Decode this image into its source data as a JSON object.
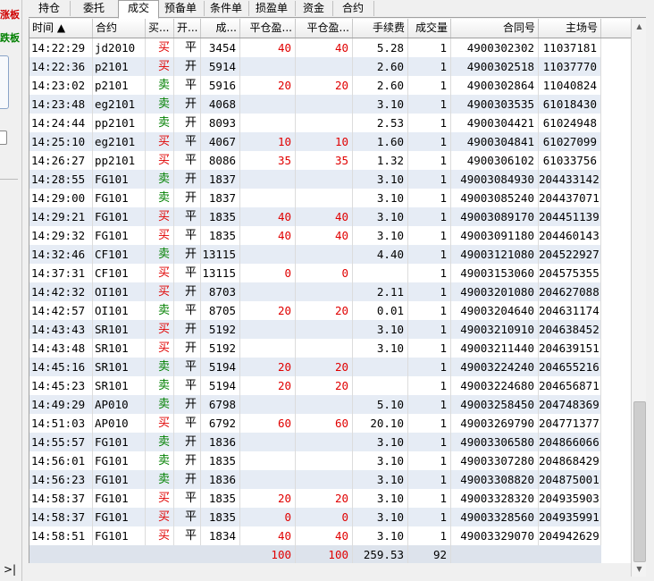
{
  "left_panel": {
    "label_1": "涨板",
    "label_2": "跌板",
    "bottom_glyph": ">|"
  },
  "tabs": [
    "持仓",
    "委托",
    "成交",
    "预备单",
    "条件单",
    "损盈单",
    "资金",
    "合约"
  ],
  "active_tab": "成交",
  "columns": [
    "时间 ▲",
    "合约",
    "买...",
    "开...",
    "成...",
    "平仓盈...",
    "平仓盈...",
    "手续费",
    "成交量",
    "合同号",
    "主场号"
  ],
  "rows": [
    {
      "time": "14:22:29",
      "contract": "jd2010",
      "side": "买",
      "oc": "平",
      "price": "3454",
      "pnl1": "40",
      "pnl2": "40",
      "fee": "5.28",
      "qty": "1",
      "order_no": "4900302302",
      "main_no": "11037181"
    },
    {
      "time": "14:22:36",
      "contract": "p2101",
      "side": "买",
      "oc": "开",
      "price": "5914",
      "pnl1": "",
      "pnl2": "",
      "fee": "2.60",
      "qty": "1",
      "order_no": "4900302518",
      "main_no": "11037770"
    },
    {
      "time": "14:23:02",
      "contract": "p2101",
      "side": "卖",
      "oc": "平",
      "price": "5916",
      "pnl1": "20",
      "pnl2": "20",
      "fee": "2.60",
      "qty": "1",
      "order_no": "4900302864",
      "main_no": "11040824"
    },
    {
      "time": "14:23:48",
      "contract": "eg2101",
      "side": "卖",
      "oc": "开",
      "price": "4068",
      "pnl1": "",
      "pnl2": "",
      "fee": "3.10",
      "qty": "1",
      "order_no": "4900303535",
      "main_no": "61018430"
    },
    {
      "time": "14:24:44",
      "contract": "pp2101",
      "side": "卖",
      "oc": "开",
      "price": "8093",
      "pnl1": "",
      "pnl2": "",
      "fee": "2.53",
      "qty": "1",
      "order_no": "4900304421",
      "main_no": "61024948"
    },
    {
      "time": "14:25:10",
      "contract": "eg2101",
      "side": "买",
      "oc": "平",
      "price": "4067",
      "pnl1": "10",
      "pnl2": "10",
      "fee": "1.60",
      "qty": "1",
      "order_no": "4900304841",
      "main_no": "61027099"
    },
    {
      "time": "14:26:27",
      "contract": "pp2101",
      "side": "买",
      "oc": "平",
      "price": "8086",
      "pnl1": "35",
      "pnl2": "35",
      "fee": "1.32",
      "qty": "1",
      "order_no": "4900306102",
      "main_no": "61033756"
    },
    {
      "time": "14:28:55",
      "contract": "FG101",
      "side": "卖",
      "oc": "开",
      "price": "1837",
      "pnl1": "",
      "pnl2": "",
      "fee": "3.10",
      "qty": "1",
      "order_no": "49003084930",
      "main_no": "204433142"
    },
    {
      "time": "14:29:00",
      "contract": "FG101",
      "side": "卖",
      "oc": "开",
      "price": "1837",
      "pnl1": "",
      "pnl2": "",
      "fee": "3.10",
      "qty": "1",
      "order_no": "49003085240",
      "main_no": "204437071"
    },
    {
      "time": "14:29:21",
      "contract": "FG101",
      "side": "买",
      "oc": "平",
      "price": "1835",
      "pnl1": "40",
      "pnl2": "40",
      "fee": "3.10",
      "qty": "1",
      "order_no": "49003089170",
      "main_no": "204451139"
    },
    {
      "time": "14:29:32",
      "contract": "FG101",
      "side": "买",
      "oc": "平",
      "price": "1835",
      "pnl1": "40",
      "pnl2": "40",
      "fee": "3.10",
      "qty": "1",
      "order_no": "49003091180",
      "main_no": "204460143"
    },
    {
      "time": "14:32:46",
      "contract": "CF101",
      "side": "卖",
      "oc": "开",
      "price": "13115",
      "pnl1": "",
      "pnl2": "",
      "fee": "4.40",
      "qty": "1",
      "order_no": "49003121080",
      "main_no": "204522927"
    },
    {
      "time": "14:37:31",
      "contract": "CF101",
      "side": "买",
      "oc": "平",
      "price": "13115",
      "pnl1": "0",
      "pnl2": "0",
      "fee": "",
      "qty": "1",
      "order_no": "49003153060",
      "main_no": "204575355"
    },
    {
      "time": "14:42:32",
      "contract": "OI101",
      "side": "买",
      "oc": "开",
      "price": "8703",
      "pnl1": "",
      "pnl2": "",
      "fee": "2.11",
      "qty": "1",
      "order_no": "49003201080",
      "main_no": "204627088"
    },
    {
      "time": "14:42:57",
      "contract": "OI101",
      "side": "卖",
      "oc": "平",
      "price": "8705",
      "pnl1": "20",
      "pnl2": "20",
      "fee": "0.01",
      "qty": "1",
      "order_no": "49003204640",
      "main_no": "204631174"
    },
    {
      "time": "14:43:43",
      "contract": "SR101",
      "side": "买",
      "oc": "开",
      "price": "5192",
      "pnl1": "",
      "pnl2": "",
      "fee": "3.10",
      "qty": "1",
      "order_no": "49003210910",
      "main_no": "204638452"
    },
    {
      "time": "14:43:48",
      "contract": "SR101",
      "side": "买",
      "oc": "开",
      "price": "5192",
      "pnl1": "",
      "pnl2": "",
      "fee": "3.10",
      "qty": "1",
      "order_no": "49003211440",
      "main_no": "204639151"
    },
    {
      "time": "14:45:16",
      "contract": "SR101",
      "side": "卖",
      "oc": "平",
      "price": "5194",
      "pnl1": "20",
      "pnl2": "20",
      "fee": "",
      "qty": "1",
      "order_no": "49003224240",
      "main_no": "204655216"
    },
    {
      "time": "14:45:23",
      "contract": "SR101",
      "side": "卖",
      "oc": "平",
      "price": "5194",
      "pnl1": "20",
      "pnl2": "20",
      "fee": "",
      "qty": "1",
      "order_no": "49003224680",
      "main_no": "204656871"
    },
    {
      "time": "14:49:29",
      "contract": "AP010",
      "side": "卖",
      "oc": "开",
      "price": "6798",
      "pnl1": "",
      "pnl2": "",
      "fee": "5.10",
      "qty": "1",
      "order_no": "49003258450",
      "main_no": "204748369"
    },
    {
      "time": "14:51:03",
      "contract": "AP010",
      "side": "买",
      "oc": "平",
      "price": "6792",
      "pnl1": "60",
      "pnl2": "60",
      "fee": "20.10",
      "qty": "1",
      "order_no": "49003269790",
      "main_no": "204771377"
    },
    {
      "time": "14:55:57",
      "contract": "FG101",
      "side": "卖",
      "oc": "开",
      "price": "1836",
      "pnl1": "",
      "pnl2": "",
      "fee": "3.10",
      "qty": "1",
      "order_no": "49003306580",
      "main_no": "204866066"
    },
    {
      "time": "14:56:01",
      "contract": "FG101",
      "side": "卖",
      "oc": "开",
      "price": "1835",
      "pnl1": "",
      "pnl2": "",
      "fee": "3.10",
      "qty": "1",
      "order_no": "49003307280",
      "main_no": "204868429"
    },
    {
      "time": "14:56:23",
      "contract": "FG101",
      "side": "卖",
      "oc": "开",
      "price": "1836",
      "pnl1": "",
      "pnl2": "",
      "fee": "3.10",
      "qty": "1",
      "order_no": "49003308820",
      "main_no": "204875001"
    },
    {
      "time": "14:58:37",
      "contract": "FG101",
      "side": "买",
      "oc": "平",
      "price": "1835",
      "pnl1": "20",
      "pnl2": "20",
      "fee": "3.10",
      "qty": "1",
      "order_no": "49003328320",
      "main_no": "204935903"
    },
    {
      "time": "14:58:37",
      "contract": "FG101",
      "side": "买",
      "oc": "平",
      "price": "1835",
      "pnl1": "0",
      "pnl2": "0",
      "fee": "3.10",
      "qty": "1",
      "order_no": "49003328560",
      "main_no": "204935991"
    },
    {
      "time": "14:58:51",
      "contract": "FG101",
      "side": "买",
      "oc": "平",
      "price": "1834",
      "pnl1": "40",
      "pnl2": "40",
      "fee": "3.10",
      "qty": "1",
      "order_no": "49003329070",
      "main_no": "204942629"
    }
  ],
  "summary": {
    "pnl1": "100",
    "pnl2": "100",
    "fee": "259.53",
    "qty": "92"
  },
  "colors": {
    "buy": "#e00000",
    "sell": "#008000",
    "row_alt": "#e6ecf5"
  },
  "icons": {
    "scroll_up": "triangle-up-icon",
    "scroll_down": "triangle-down-icon"
  }
}
